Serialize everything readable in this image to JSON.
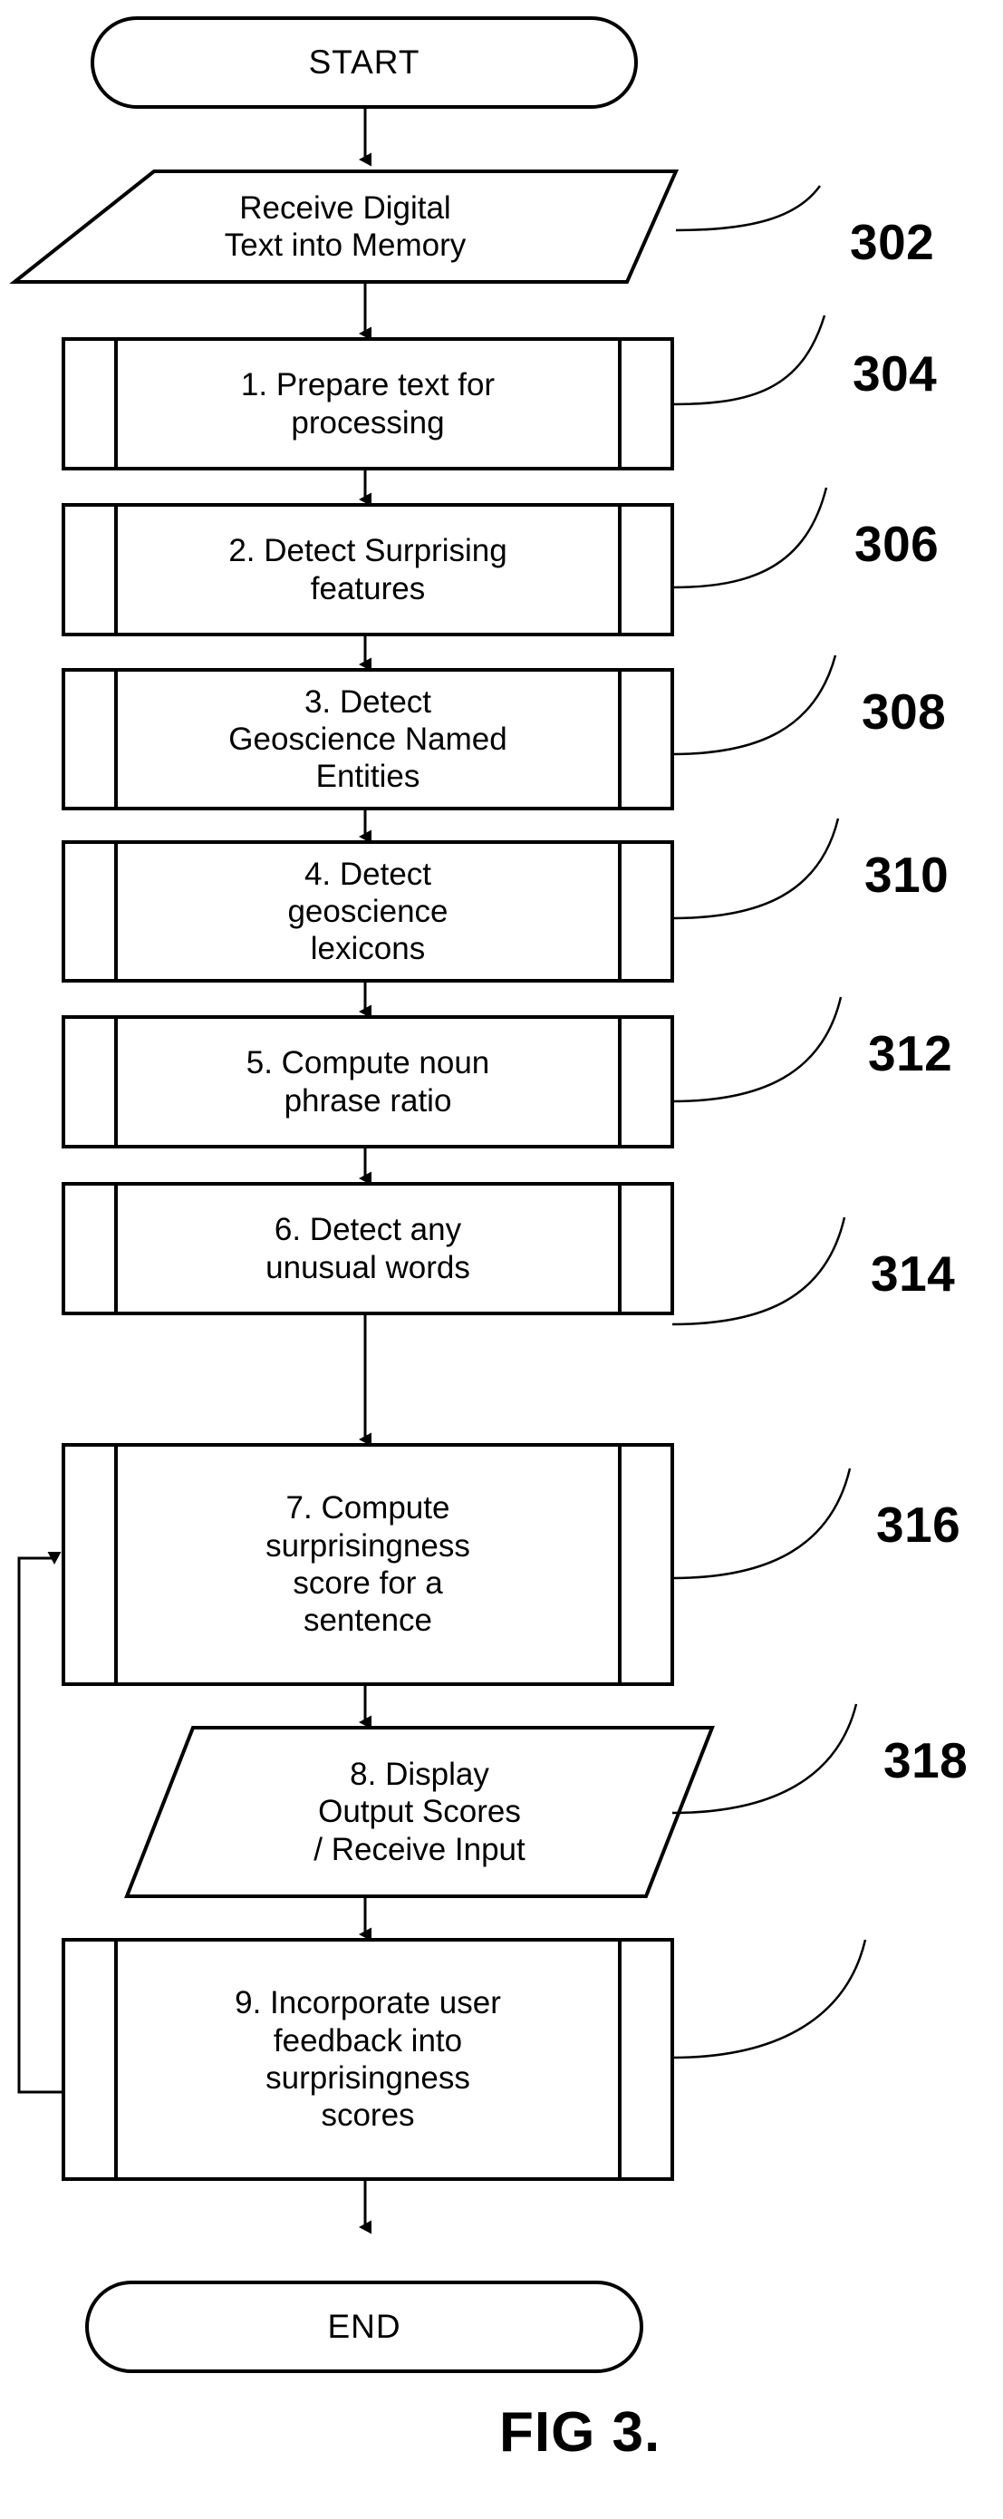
{
  "figure": {
    "caption": "FIG 3."
  },
  "terminators": {
    "start": "START",
    "end": "END"
  },
  "io_steps": [
    {
      "id": "receive-text",
      "lines": [
        "Receive Digital",
        "Text into Memory"
      ],
      "ref": "302"
    },
    {
      "id": "display-output",
      "lines": [
        "8. Display",
        "Output Scores",
        "/ Receive Input"
      ],
      "ref": "316"
    }
  ],
  "process_steps": [
    {
      "id": "step-1",
      "number": "1.",
      "lines": [
        "1. Prepare text for",
        "processing"
      ],
      "ref": "304"
    },
    {
      "id": "step-2",
      "number": "2.",
      "lines": [
        "2. Detect Surprising",
        "features"
      ],
      "ref": "306"
    },
    {
      "id": "step-3",
      "number": "3.",
      "lines": [
        "3. Detect",
        "Geoscience Named",
        "Entities"
      ],
      "ref": "308"
    },
    {
      "id": "step-4",
      "number": "4.",
      "lines": [
        "4. Detect",
        "geoscience",
        "lexicons"
      ],
      "ref": "310"
    },
    {
      "id": "step-5",
      "number": "5.",
      "lines": [
        "5. Compute noun",
        "phrase ratio"
      ],
      "ref": "312"
    },
    {
      "id": "step-6",
      "number": "6.",
      "lines": [
        "6. Detect any",
        "unusual words"
      ],
      "ref": "314"
    },
    {
      "id": "step-7",
      "number": "7.",
      "lines": [
        "7. Compute",
        "surprisingness",
        "score for a",
        "sentence"
      ],
      "ref": "314"
    },
    {
      "id": "step-9",
      "number": "9.",
      "lines": [
        "9. Incorporate user",
        "feedback into",
        "surprisingness",
        "scores"
      ],
      "ref": "318"
    }
  ],
  "reference_numbers": [
    {
      "label": "302",
      "target": "receive-text"
    },
    {
      "label": "304",
      "target": "step-1"
    },
    {
      "label": "306",
      "target": "step-2"
    },
    {
      "label": "308",
      "target": "step-3"
    },
    {
      "label": "310",
      "target": "step-4"
    },
    {
      "label": "312",
      "target": "step-5"
    },
    {
      "label": "314",
      "target": "step-7"
    },
    {
      "label": "316",
      "target": "display-output"
    },
    {
      "label": "318",
      "target": "step-9"
    }
  ],
  "flow_text": {
    "start": "START",
    "receive_l1": "Receive Digital",
    "receive_l2": "Text into Memory",
    "s1_l1": "1. Prepare text for",
    "s1_l2": "processing",
    "s2_l1": "2. Detect Surprising",
    "s2_l2": "features",
    "s3_l1": "3. Detect",
    "s3_l2": "Geoscience Named",
    "s3_l3": "Entities",
    "s4_l1": "4. Detect",
    "s4_l2": "geoscience",
    "s4_l3": "lexicons",
    "s5_l1": "5. Compute noun",
    "s5_l2": "phrase ratio",
    "s6_l1": "6. Detect any",
    "s6_l2": "unusual words",
    "s7_l1": "7. Compute",
    "s7_l2": "surprisingness",
    "s7_l3": "score for a",
    "s7_l4": "sentence",
    "s8_l1": "8. Display",
    "s8_l2": "Output Scores",
    "s8_l3": "/ Receive Input",
    "s9_l1": "9. Incorporate user",
    "s9_l2": "feedback into",
    "s9_l3": "surprisingness",
    "s9_l4": "scores",
    "end": "END",
    "ref302": "302",
    "ref304": "304",
    "ref306": "306",
    "ref308": "308",
    "ref310": "310",
    "ref312": "312",
    "ref314": "314",
    "ref316": "316",
    "ref318": "318",
    "caption": "FIG 3."
  },
  "colors": {
    "stroke": "#000000",
    "background": "#ffffff",
    "text": "#000000"
  }
}
